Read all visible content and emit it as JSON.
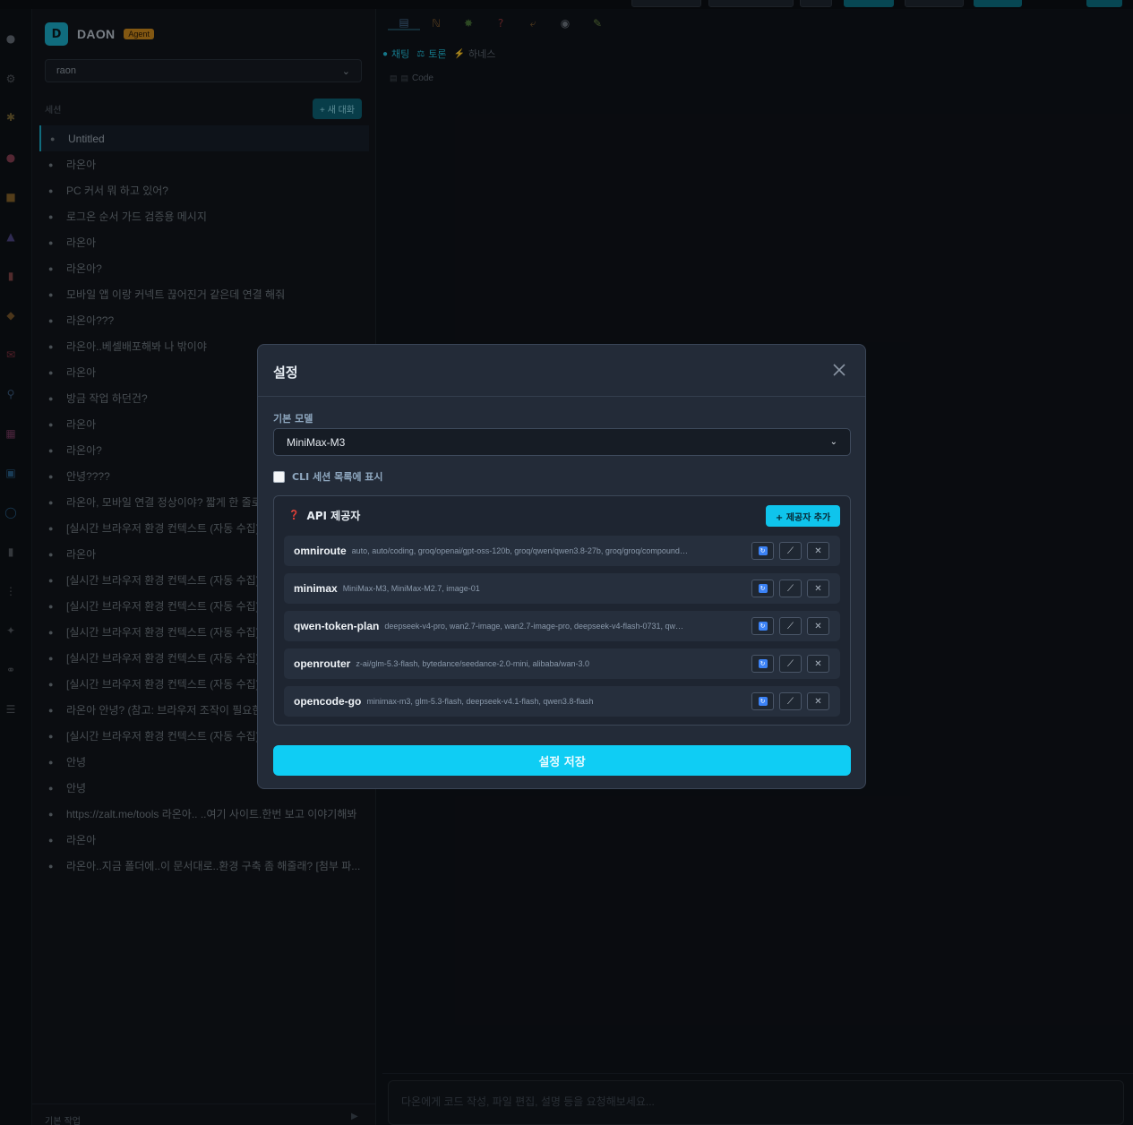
{
  "sidebar": {
    "brand_initial": "D",
    "brand_name": "DAON",
    "brand_badge": "Agent",
    "workspace": "raon",
    "section_label": "세션",
    "new_chat": "+ 새 대화",
    "sessions": [
      "Untitled",
      "라온아",
      "PC 커서 뭐 하고 있어?",
      "로그온 순서 가드 검증용 메시지",
      "라온아",
      "라온아?",
      "모바일 앱 이랑 커넥트 끊어진거 같은데 연결 해줘",
      "라온아???",
      "라온아..베셀배포해봐 나 밖이야",
      "라온아",
      "방금 작업 하던건?",
      "라온아",
      "라온아?",
      "안녕????",
      "라온아, 모바일 연결 정상이야? 짧게 한 줄로",
      "[실시간 브라우저 환경 컨텍스트 (자동 수집)",
      "라온아",
      "[실시간 브라우저 환경 컨텍스트 (자동 수집)",
      "[실시간 브라우저 환경 컨텍스트 (자동 수집)",
      "[실시간 브라우저 환경 컨텍스트 (자동 수집)",
      "[실시간 브라우저 환경 컨텍스트 (자동 수집)",
      "[실시간 브라우저 환경 컨텍스트 (자동 수집)",
      "라온아 안녕? (참고: 브라우저 조작이 필요한",
      "[실시간 브라우저 환경 컨텍스트 (자동 수집)",
      "안녕",
      "안녕",
      "https://zalt.me/tools 라온아.. ..여기 사이트.한번 보고 이야기해봐",
      "라온아",
      "라온아..지금 폴더에..이 문서대로..환경 구축 좀 해줄래? [첨부 파..."
    ],
    "footer_label": "기본 작업"
  },
  "main": {
    "mode_tabs": [
      "채팅",
      "토론",
      "하네스"
    ],
    "sub_tab": "Code",
    "input_placeholder": "다온에게 코드 작성, 파일 편집, 설명 등을 요청해보세요..."
  },
  "modal": {
    "title": "설정",
    "model_label": "기본 모델",
    "model_value": "MiniMax-M3",
    "cli_label": "CLI 세션 목록에 표시",
    "cli_checked": false,
    "providers_title": "API 제공자",
    "add_provider": "+ 제공자 추가",
    "providers": [
      {
        "name": "omniroute",
        "models": "auto, auto/coding, groq/openai/gpt-oss-120b, groq/qwen/qwen3.8-27b, groq/groq/compound, n..."
      },
      {
        "name": "minimax",
        "models": "MiniMax-M3, MiniMax-M2.7, image-01"
      },
      {
        "name": "qwen-token-plan",
        "models": "deepseek-v4-pro, wan2.7-image, wan2.7-image-pro, deepseek-v4-flash-0731, qwen3.8-m..."
      },
      {
        "name": "openrouter",
        "models": "z-ai/glm-5.3-flash, bytedance/seedance-2.0-mini, alibaba/wan-3.0"
      },
      {
        "name": "opencode-go",
        "models": "minimax-m3, glm-5.3-flash, deepseek-v4.1-flash, qwen3.8-flash"
      }
    ],
    "save": "설정 저장"
  },
  "colors": {
    "accent": "#0fcdf4",
    "badge": "#c8861d",
    "modal_bg": "#232b38"
  }
}
